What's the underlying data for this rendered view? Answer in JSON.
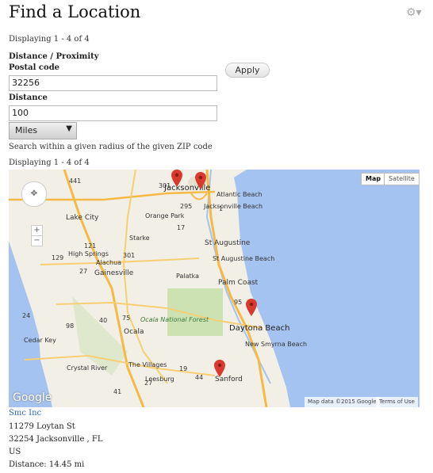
{
  "page": {
    "title": "Find a Location"
  },
  "header": {
    "displaying_top": "Displaying 1 - 4 of 4"
  },
  "form": {
    "section_label": "Distance / Proximity",
    "postal_label": "Postal code",
    "postal_value": "32256",
    "distance_label": "Distance",
    "distance_value": "100",
    "unit_selected": "Miles",
    "apply_label": "Apply",
    "help_text": "Search within a given radius of the given ZIP code"
  },
  "displaying_bottom": "Displaying 1 - 4 of 4",
  "map": {
    "map_type_map": "Map",
    "map_type_satellite": "Satellite",
    "attribution": "Map data ©2015 Google",
    "terms": "Terms of Use",
    "google_logo": "Google",
    "labels": {
      "jacksonville": "Jacksonville",
      "atlantic_beach": "Atlantic Beach",
      "jacksonville_beach": "Jacksonville Beach",
      "orange_park": "Orange Park",
      "lake_city": "Lake City",
      "starke": "Starke",
      "st_augustine": "St Augustine",
      "st_augustine_beach": "St Augustine Beach",
      "high_springs": "High Springs",
      "alachua": "Alachua",
      "gainesville": "Gainesville",
      "palatka": "Palatka",
      "palm_coast": "Palm Coast",
      "ocala_nf": "Ocala National Forest",
      "ocala": "Ocala",
      "daytona": "Daytona Beach",
      "new_smyrna": "New Smyrna Beach",
      "cedar_key": "Cedar Key",
      "crystal_river": "Crystal River",
      "the_villages": "The Villages",
      "leesburg": "Leesburg",
      "sanford": "Sanford",
      "i295": "295",
      "i95": "95",
      "i75": "75",
      "us441": "441",
      "us301": "301",
      "r121": "121",
      "r129": "129",
      "r27": "27",
      "r98": "98",
      "r40": "40",
      "r41": "41",
      "r19": "19",
      "r44": "44",
      "r17": "17",
      "r1": "1",
      "r301b": "301",
      "r24": "24",
      "r27b": "27"
    }
  },
  "result": {
    "name": "Smc Inc",
    "street": "11279 Loytan St",
    "city_line": "32254 Jacksonville , FL",
    "country": "US",
    "distance": "Distance: 14.45 mi"
  },
  "colors": {
    "link": "#2a6ab3",
    "water": "#a5c3f0",
    "pin": "#d83a30"
  }
}
